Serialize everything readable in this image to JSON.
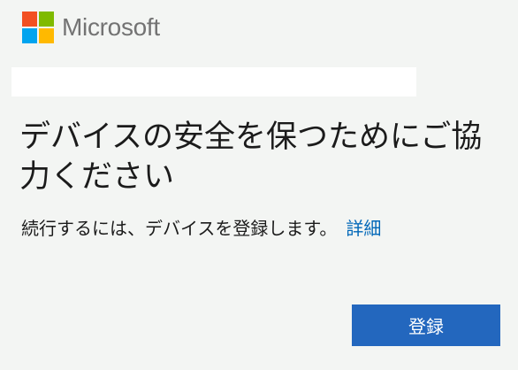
{
  "header": {
    "brand_name": "Microsoft",
    "logo_icon": "microsoft-four-squares-icon",
    "logo_colors": [
      "#f25022",
      "#7fba00",
      "#00a4ef",
      "#ffb900"
    ]
  },
  "main": {
    "title": "デバイスの安全を保つためにご協力ください",
    "description": "続行するには、デバイスを登録します。",
    "details_link": "詳細"
  },
  "actions": {
    "register_label": "登録"
  },
  "colors": {
    "background": "#f3f5f3",
    "primary_button": "#2367be",
    "link": "#0067b8"
  }
}
